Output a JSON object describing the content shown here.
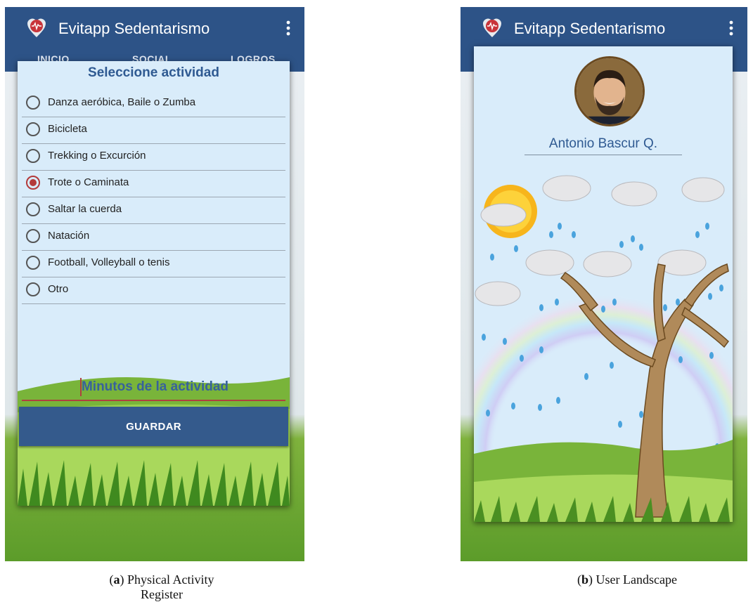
{
  "app": {
    "title": "Evitapp Sedentarismo",
    "tabs": [
      "INICIO",
      "SOCIAL",
      "LOGROS"
    ],
    "bar_color": "#2d5387"
  },
  "activity_dialog": {
    "title": "Seleccione actividad",
    "options": [
      {
        "label": "Danza aeróbica, Baile o Zumba",
        "selected": false
      },
      {
        "label": "Bicicleta",
        "selected": false
      },
      {
        "label": "Trekking o Excurción",
        "selected": false
      },
      {
        "label": "Trote o Caminata",
        "selected": true
      },
      {
        "label": "Saltar la cuerda",
        "selected": false
      },
      {
        "label": "Natación",
        "selected": false
      },
      {
        "label": "Football, Volleyball o tenis",
        "selected": false
      },
      {
        "label": "Otro",
        "selected": false
      }
    ],
    "minutes_placeholder": "Minutos de la actividad",
    "save_label": "GUARDAR"
  },
  "profile": {
    "name": "Antonio Bascur Q.",
    "avatar_icon": "user-photo-icon"
  },
  "captions": {
    "a_letter": "a",
    "a_text": "Physical Activity Register",
    "b_letter": "b",
    "b_text": "User Landscape"
  },
  "colors": {
    "accent": "#2f5a92",
    "radio_selected": "#b33a3a",
    "dialog_bg": "#d9ecfa",
    "grass": "#6aa92e"
  }
}
